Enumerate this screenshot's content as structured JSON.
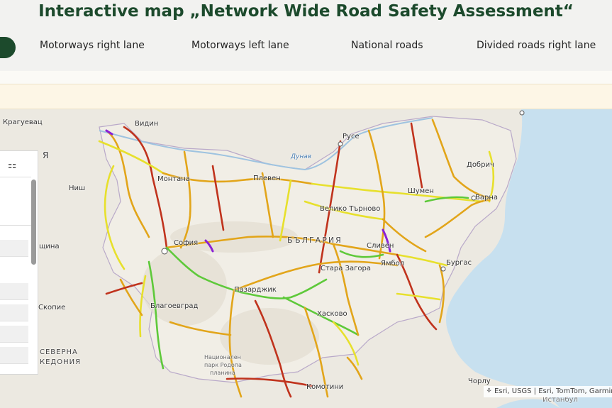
{
  "header": {
    "title": "Interactive map „Network Wide Road Safety Assessment“"
  },
  "tabs": [
    {
      "label": "Motorways right lane"
    },
    {
      "label": "Motorways left lane"
    },
    {
      "label": "National roads"
    },
    {
      "label": "Divided roads right lane"
    }
  ],
  "map": {
    "labels": {
      "kraguevac": "Крагуевац",
      "vidin": "Видин",
      "nish": "Ниш",
      "montana": "Монтана",
      "pleven": "Плевен",
      "ruse": "Русе",
      "dunav": "Дунав",
      "dobrich": "Добрич",
      "shumen": "Шумен",
      "varna": "Варна",
      "veliko_tarnovo": "Велико Търново",
      "bulgaria": "БЪЛГАРИЯ",
      "sofia": "София",
      "sliven": "Сливен",
      "stara_zagora": "Стара Загора",
      "yambol": "Ямбол",
      "burgas": "Бургас",
      "blagoevgrad": "Благоевград",
      "pazardzhik": "Пазарджик",
      "haskovo": "Хасково",
      "skopie": "Скопие",
      "severna": "СЕВЕРНА",
      "makedonia": "КЕДОНИЯ",
      "park1": "Национален",
      "park2": "парк Родопа",
      "park3": "планина",
      "komotini": "Комотини",
      "chorlu": "Чорлу",
      "istanbul": "Истанбул",
      "ya": "Я",
      "shchina": "щина"
    },
    "attribution": "Esri, USGS | Esri, TomTom, Garmin",
    "colors": {
      "sea": "#c7e0ef",
      "land": "#ece9e1",
      "high": "#e2a51a",
      "very_high": "#c0331d",
      "medium": "#e7e02c",
      "low": "#5ec93a",
      "extreme": "#8a20d6"
    }
  }
}
